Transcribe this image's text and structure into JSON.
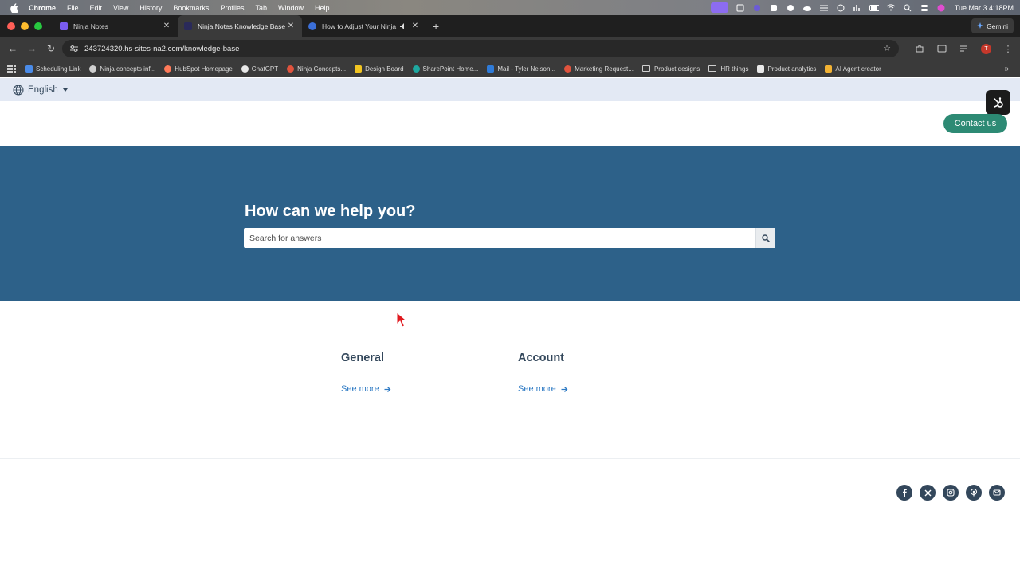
{
  "menubar": {
    "app_name": "Chrome",
    "items": [
      "File",
      "Edit",
      "View",
      "History",
      "Bookmarks",
      "Profiles",
      "Tab",
      "Window",
      "Help"
    ],
    "clock": "Tue Mar 3  4:18PM"
  },
  "tabs": [
    {
      "label": "Ninja Notes",
      "favicon_color": "#7a5cf0",
      "active": false
    },
    {
      "label": "Ninja Notes Knowledge Base",
      "favicon_color": "#2a2a5a",
      "active": true
    },
    {
      "label": "How to Adjust Your Ninja",
      "favicon_color": "#3b6fd8",
      "active": false
    }
  ],
  "gemini_label": "Gemini",
  "address": {
    "url": "243724320.hs-sites-na2.com/knowledge-base"
  },
  "bookmarks": [
    {
      "label": "Scheduling Link",
      "icon_color": "#4a8be8"
    },
    {
      "label": "Ninja concepts inf...",
      "icon_color": "#cfcfcf"
    },
    {
      "label": "HubSpot Homepage",
      "icon_color": "#ff7a59"
    },
    {
      "label": "ChatGPT",
      "icon_color": "#e8e8e8"
    },
    {
      "label": "Ninja Concepts...",
      "icon_color": "#e0533d"
    },
    {
      "label": "Design Board",
      "icon_color": "#f2c521"
    },
    {
      "label": "SharePoint Home...",
      "icon_color": "#1ea8a0"
    },
    {
      "label": "Mail - Tyler Nelson...",
      "icon_color": "#2f7bd8"
    },
    {
      "label": "Marketing Request...",
      "icon_color": "#e0533d"
    },
    {
      "label": "Product designs",
      "icon_color": "folder"
    },
    {
      "label": "HR things",
      "icon_color": "folder"
    },
    {
      "label": "Product analytics",
      "icon_color": "#e8e8e8"
    },
    {
      "label": "AI Agent creator",
      "icon_color": "#f2b233"
    }
  ],
  "page": {
    "language": "English",
    "contact_label": "Contact us",
    "hero_title": "How can we help you?",
    "search_placeholder": "Search for answers",
    "categories": [
      {
        "title": "General",
        "link": "See more"
      },
      {
        "title": "Account",
        "link": "See more"
      }
    ],
    "socials": [
      "facebook-icon",
      "x-icon",
      "instagram-icon",
      "podcast-icon",
      "email-icon"
    ]
  },
  "colors": {
    "hero_bg": "#2d6189",
    "contact_bg": "#2d8a74",
    "heading_text": "#33475b",
    "link": "#2f7bc4",
    "lang_bar_bg": "#e3e9f4"
  }
}
